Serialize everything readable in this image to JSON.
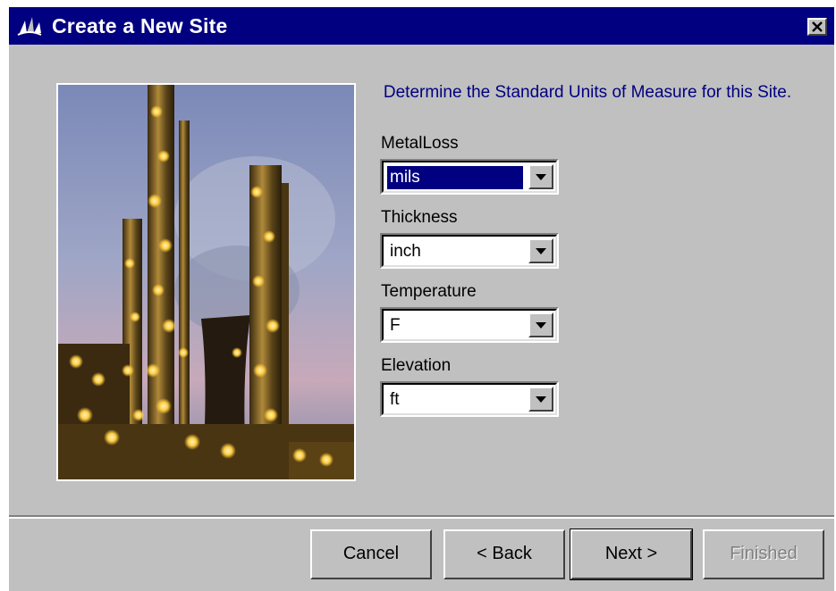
{
  "window": {
    "title": "Create a New Site",
    "close_label": "×"
  },
  "image": {
    "description_icon": "refinery-photo"
  },
  "form": {
    "heading": "Determine the Standard Units of Measure for this Site.",
    "fields": [
      {
        "label": "MetalLoss",
        "value": "mils",
        "selected": true
      },
      {
        "label": "Thickness",
        "value": "inch",
        "selected": false
      },
      {
        "label": "Temperature",
        "value": "F",
        "selected": false
      },
      {
        "label": "Elevation",
        "value": "ft",
        "selected": false
      }
    ]
  },
  "buttons": {
    "cancel": "Cancel",
    "back": "< Back",
    "next": "Next >",
    "finished": "Finished"
  },
  "colors": {
    "titlebar": "#000080",
    "dialog_bg": "#c0c0c0",
    "heading": "#000080",
    "selection": "#000080"
  }
}
